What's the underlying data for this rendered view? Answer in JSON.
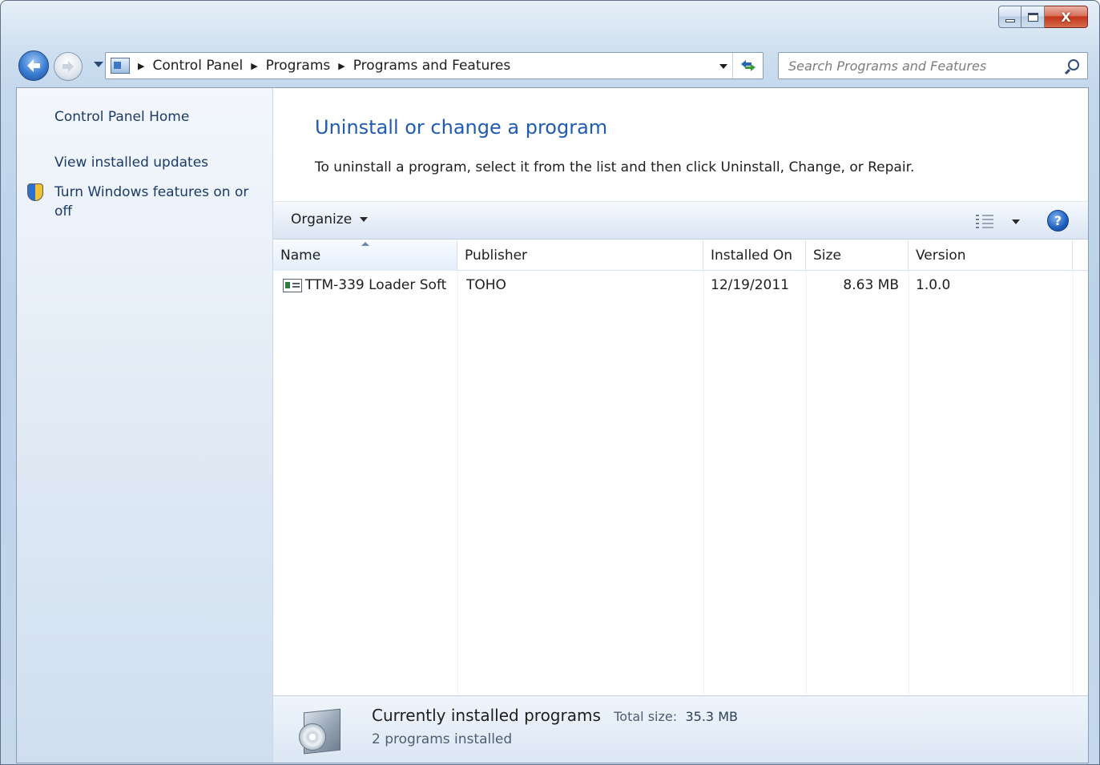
{
  "window": {
    "caption": {
      "minimize": "–",
      "maximize": "□",
      "close": "X"
    }
  },
  "navigation": {
    "breadcrumbs": [
      "Control Panel",
      "Programs",
      "Programs and Features"
    ],
    "search_placeholder": "Search Programs and Features"
  },
  "sidebar": {
    "items": [
      {
        "label": "Control Panel Home"
      },
      {
        "label": "View installed updates"
      },
      {
        "label": "Turn Windows features on or off",
        "line1": "Turn Windows features on or",
        "line2": "off"
      }
    ]
  },
  "main": {
    "title": "Uninstall or change a program",
    "instructions": "To uninstall a program, select it from the list and then click Uninstall, Change, or Repair.",
    "toolbar": {
      "organize_label": "Organize",
      "help": "?"
    },
    "columns": [
      "Name",
      "Publisher",
      "Installed On",
      "Size",
      "Version"
    ],
    "sorted_column": "Name",
    "rows": [
      {
        "name": "TTM-339 Loader Soft",
        "publisher": "TOHO",
        "installed_on": "12/19/2011",
        "size": "8.63 MB",
        "version": "1.0.0"
      }
    ]
  },
  "details": {
    "title": "Currently installed programs",
    "total_size_label": "Total size:",
    "total_size_value": "35.3 MB",
    "count": "2 programs installed"
  },
  "colors": {
    "title_blue": "#1f5bb3",
    "link_blue": "#1e3a66",
    "close_red": "#c2351a"
  }
}
